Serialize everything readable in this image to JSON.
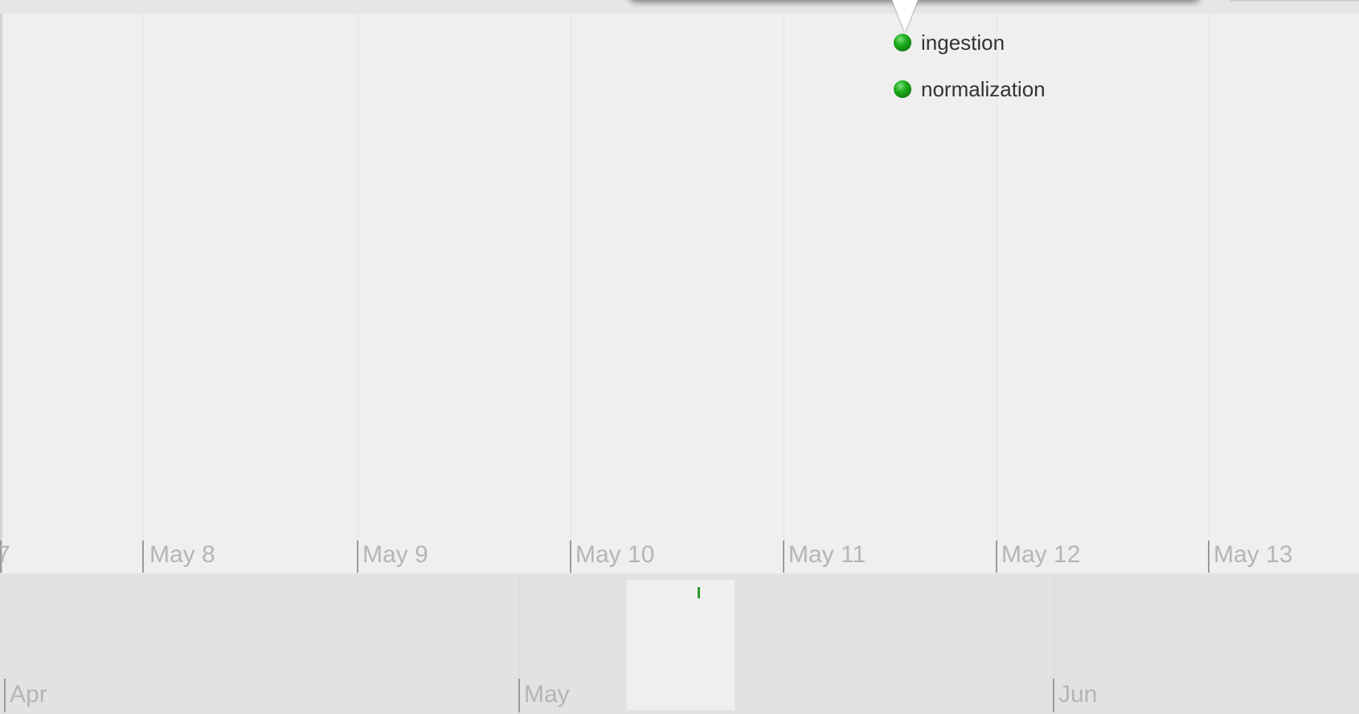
{
  "timeline": {
    "events": [
      {
        "label": "ingestion",
        "status": "green-dot-icon"
      },
      {
        "label": "normalization",
        "status": "green-dot-icon"
      }
    ],
    "day_ticks": [
      "May 8",
      "May 9",
      "May 10",
      "May 11",
      "May 12",
      "May 13"
    ],
    "cut_tick_char": "7",
    "month_ticks": [
      "Apr",
      "May",
      "Jun"
    ]
  },
  "colors": {
    "event_dot": "#1fae1f",
    "overview_marker": "#2e9a2e",
    "tick_label": "#b5b5b5",
    "background": "#efefef"
  }
}
